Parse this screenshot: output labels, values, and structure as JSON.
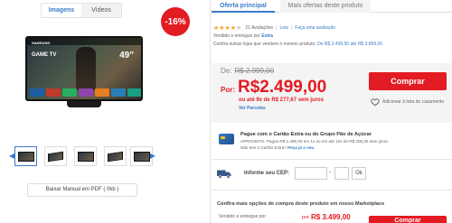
{
  "media_tabs": {
    "images": "Imagens",
    "videos": "Vídeos"
  },
  "discount_badge": "-16%",
  "tv": {
    "brand": "SAMSUNG",
    "promo": "GAME TV",
    "size": "49\""
  },
  "gallery": {
    "prev_icon": "chevron-left-icon",
    "next_icon": "chevron-right-icon"
  },
  "manual_button": "Baixar Manual em PDF ( 0kb )",
  "offer_tabs": {
    "main": "Oferta principal",
    "other": "Mais ofertas deste produto"
  },
  "rating": {
    "stars": 4,
    "reviews": "21 Avaliações",
    "read": "Leia",
    "write": "Faça uma avaliação"
  },
  "seller": {
    "prefix": "Vendido e entregue por",
    "name": "Extra"
  },
  "compare": {
    "text": "Confira outras lojas que vendem o mesmo produto:",
    "range": "De R$ 2.499,00 até R$ 3.899,00"
  },
  "price": {
    "old_label": "De:",
    "old_value": "R$ 2.999,00",
    "new_label": "Por:",
    "new_value": "R$2.499,00",
    "installments_prefix": "ou até 9x de R$ 277,67",
    "installments_suffix": "sem juros",
    "see_installments": "Ver Parcelas"
  },
  "buy_button": "Comprar",
  "wedding_list": "Adicionar à lista de casamento",
  "card_offer": {
    "title": "Pague com o Cartão Extra ou do Grupo Pão de Açúcar",
    "line1": "APROVEITE: Pague R$ 2.499,00 em 1x ou em até 12x de R$ 208,25 sem juros.",
    "line2_prefix": "Não tem o Cartão Extra?",
    "line2_link": "Peça já o seu."
  },
  "cep": {
    "label": "Informe seu CEP:",
    "ok": "Ok"
  },
  "marketplace": {
    "title": "Confira mais opções de compra deste produto em nosso Marketplace",
    "seller_prefix": "Vendido e entregue por",
    "por": "por",
    "price": "R$ 3.499,00",
    "button": "Comprar"
  },
  "colors": {
    "accent_red": "#e31b23",
    "link_blue": "#3a7bc8",
    "star": "#f5a623"
  }
}
